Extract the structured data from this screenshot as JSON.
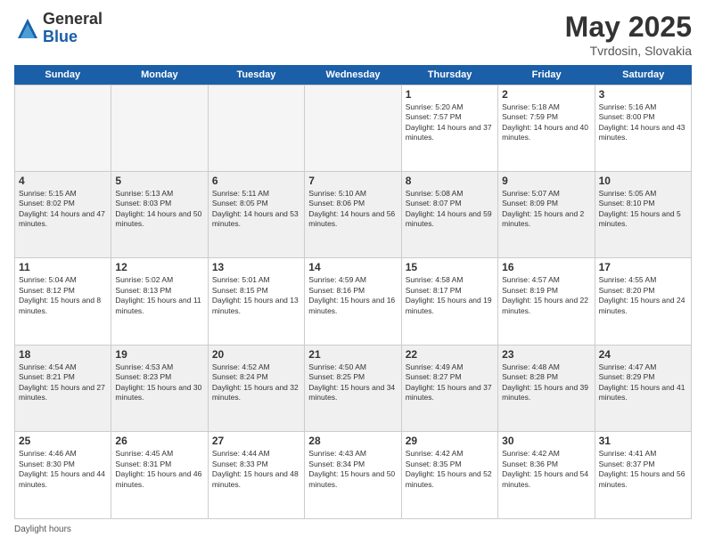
{
  "header": {
    "logo_general": "General",
    "logo_blue": "Blue",
    "main_title": "May 2025",
    "subtitle": "Tvrdosin, Slovakia"
  },
  "calendar": {
    "days_of_week": [
      "Sunday",
      "Monday",
      "Tuesday",
      "Wednesday",
      "Thursday",
      "Friday",
      "Saturday"
    ],
    "weeks": [
      [
        {
          "day": "",
          "empty": true
        },
        {
          "day": "",
          "empty": true
        },
        {
          "day": "",
          "empty": true
        },
        {
          "day": "",
          "empty": true
        },
        {
          "day": "1",
          "sunrise": "5:20 AM",
          "sunset": "7:57 PM",
          "daylight": "14 hours and 37 minutes."
        },
        {
          "day": "2",
          "sunrise": "5:18 AM",
          "sunset": "7:59 PM",
          "daylight": "14 hours and 40 minutes."
        },
        {
          "day": "3",
          "sunrise": "5:16 AM",
          "sunset": "8:00 PM",
          "daylight": "14 hours and 43 minutes."
        }
      ],
      [
        {
          "day": "4",
          "sunrise": "5:15 AM",
          "sunset": "8:02 PM",
          "daylight": "14 hours and 47 minutes."
        },
        {
          "day": "5",
          "sunrise": "5:13 AM",
          "sunset": "8:03 PM",
          "daylight": "14 hours and 50 minutes."
        },
        {
          "day": "6",
          "sunrise": "5:11 AM",
          "sunset": "8:05 PM",
          "daylight": "14 hours and 53 minutes."
        },
        {
          "day": "7",
          "sunrise": "5:10 AM",
          "sunset": "8:06 PM",
          "daylight": "14 hours and 56 minutes."
        },
        {
          "day": "8",
          "sunrise": "5:08 AM",
          "sunset": "8:07 PM",
          "daylight": "14 hours and 59 minutes."
        },
        {
          "day": "9",
          "sunrise": "5:07 AM",
          "sunset": "8:09 PM",
          "daylight": "15 hours and 2 minutes."
        },
        {
          "day": "10",
          "sunrise": "5:05 AM",
          "sunset": "8:10 PM",
          "daylight": "15 hours and 5 minutes."
        }
      ],
      [
        {
          "day": "11",
          "sunrise": "5:04 AM",
          "sunset": "8:12 PM",
          "daylight": "15 hours and 8 minutes."
        },
        {
          "day": "12",
          "sunrise": "5:02 AM",
          "sunset": "8:13 PM",
          "daylight": "15 hours and 11 minutes."
        },
        {
          "day": "13",
          "sunrise": "5:01 AM",
          "sunset": "8:15 PM",
          "daylight": "15 hours and 13 minutes."
        },
        {
          "day": "14",
          "sunrise": "4:59 AM",
          "sunset": "8:16 PM",
          "daylight": "15 hours and 16 minutes."
        },
        {
          "day": "15",
          "sunrise": "4:58 AM",
          "sunset": "8:17 PM",
          "daylight": "15 hours and 19 minutes."
        },
        {
          "day": "16",
          "sunrise": "4:57 AM",
          "sunset": "8:19 PM",
          "daylight": "15 hours and 22 minutes."
        },
        {
          "day": "17",
          "sunrise": "4:55 AM",
          "sunset": "8:20 PM",
          "daylight": "15 hours and 24 minutes."
        }
      ],
      [
        {
          "day": "18",
          "sunrise": "4:54 AM",
          "sunset": "8:21 PM",
          "daylight": "15 hours and 27 minutes."
        },
        {
          "day": "19",
          "sunrise": "4:53 AM",
          "sunset": "8:23 PM",
          "daylight": "15 hours and 30 minutes."
        },
        {
          "day": "20",
          "sunrise": "4:52 AM",
          "sunset": "8:24 PM",
          "daylight": "15 hours and 32 minutes."
        },
        {
          "day": "21",
          "sunrise": "4:50 AM",
          "sunset": "8:25 PM",
          "daylight": "15 hours and 34 minutes."
        },
        {
          "day": "22",
          "sunrise": "4:49 AM",
          "sunset": "8:27 PM",
          "daylight": "15 hours and 37 minutes."
        },
        {
          "day": "23",
          "sunrise": "4:48 AM",
          "sunset": "8:28 PM",
          "daylight": "15 hours and 39 minutes."
        },
        {
          "day": "24",
          "sunrise": "4:47 AM",
          "sunset": "8:29 PM",
          "daylight": "15 hours and 41 minutes."
        }
      ],
      [
        {
          "day": "25",
          "sunrise": "4:46 AM",
          "sunset": "8:30 PM",
          "daylight": "15 hours and 44 minutes."
        },
        {
          "day": "26",
          "sunrise": "4:45 AM",
          "sunset": "8:31 PM",
          "daylight": "15 hours and 46 minutes."
        },
        {
          "day": "27",
          "sunrise": "4:44 AM",
          "sunset": "8:33 PM",
          "daylight": "15 hours and 48 minutes."
        },
        {
          "day": "28",
          "sunrise": "4:43 AM",
          "sunset": "8:34 PM",
          "daylight": "15 hours and 50 minutes."
        },
        {
          "day": "29",
          "sunrise": "4:42 AM",
          "sunset": "8:35 PM",
          "daylight": "15 hours and 52 minutes."
        },
        {
          "day": "30",
          "sunrise": "4:42 AM",
          "sunset": "8:36 PM",
          "daylight": "15 hours and 54 minutes."
        },
        {
          "day": "31",
          "sunrise": "4:41 AM",
          "sunset": "8:37 PM",
          "daylight": "15 hours and 56 minutes."
        }
      ]
    ],
    "footer_note": "Daylight hours"
  }
}
